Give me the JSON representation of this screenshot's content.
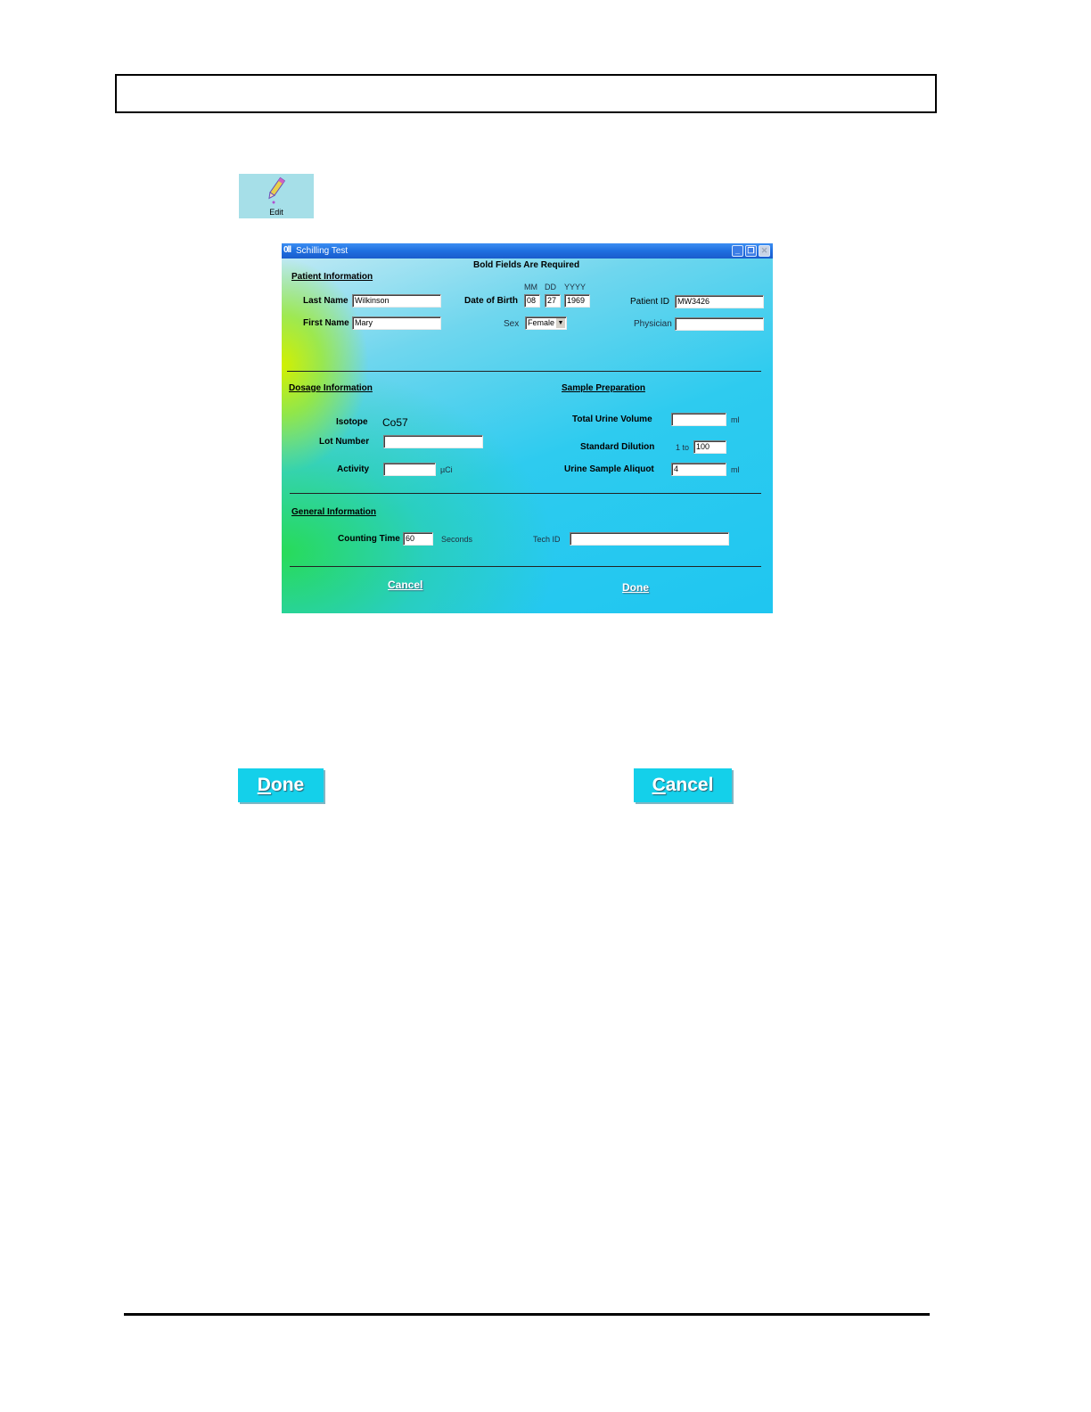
{
  "edit_icon": {
    "label": "Edit"
  },
  "dialog": {
    "title": "Schilling Test",
    "required_note": "Bold Fields Are Required",
    "patient": {
      "section_title": "Patient Information",
      "last_name_label": "Last Name",
      "last_name_value": "Wilkinson",
      "first_name_label": "First Name",
      "first_name_value": "Mary",
      "dob_label": "Date of Birth",
      "dob_mm_header": "MM",
      "dob_dd_header": "DD",
      "dob_yyyy_header": "YYYY",
      "dob_mm": "08",
      "dob_dd": "27",
      "dob_yyyy": "1969",
      "sex_label": "Sex",
      "sex_value": "Female",
      "patient_id_label": "Patient ID",
      "patient_id_value": "MW3426",
      "physician_label": "Physician",
      "physician_value": ""
    },
    "dosage": {
      "section_title": "Dosage Information",
      "isotope_label": "Isotope",
      "isotope_value": "Co57",
      "lot_label": "Lot Number",
      "lot_value": "",
      "activity_label": "Activity",
      "activity_value": "",
      "activity_unit": "µCi"
    },
    "sample": {
      "section_title": "Sample Preparation",
      "urine_volume_label": "Total Urine Volume",
      "urine_volume_value": "",
      "urine_volume_unit": "ml",
      "dilution_label": "Standard Dilution",
      "dilution_prefix": "1 to",
      "dilution_value": "100",
      "aliquot_label": "Urine Sample Aliquot",
      "aliquot_value": "4",
      "aliquot_unit": "ml"
    },
    "general": {
      "section_title": "General Information",
      "counting_time_label": "Counting Time",
      "counting_time_value": "60",
      "counting_time_unit": "Seconds",
      "tech_id_label": "Tech ID",
      "tech_id_value": ""
    },
    "cancel_label": "Cancel",
    "done_label": "Done"
  },
  "buttons": {
    "done_first": "D",
    "done_rest": "one",
    "cancel_first": "C",
    "cancel_rest": "ancel"
  },
  "colors": {
    "titlebar": "#1f6fe0",
    "button_fill": "#14d0ea",
    "window_teal": "#1fc6f0",
    "window_green": "#28dc50",
    "window_yellow": "#d2f000"
  }
}
